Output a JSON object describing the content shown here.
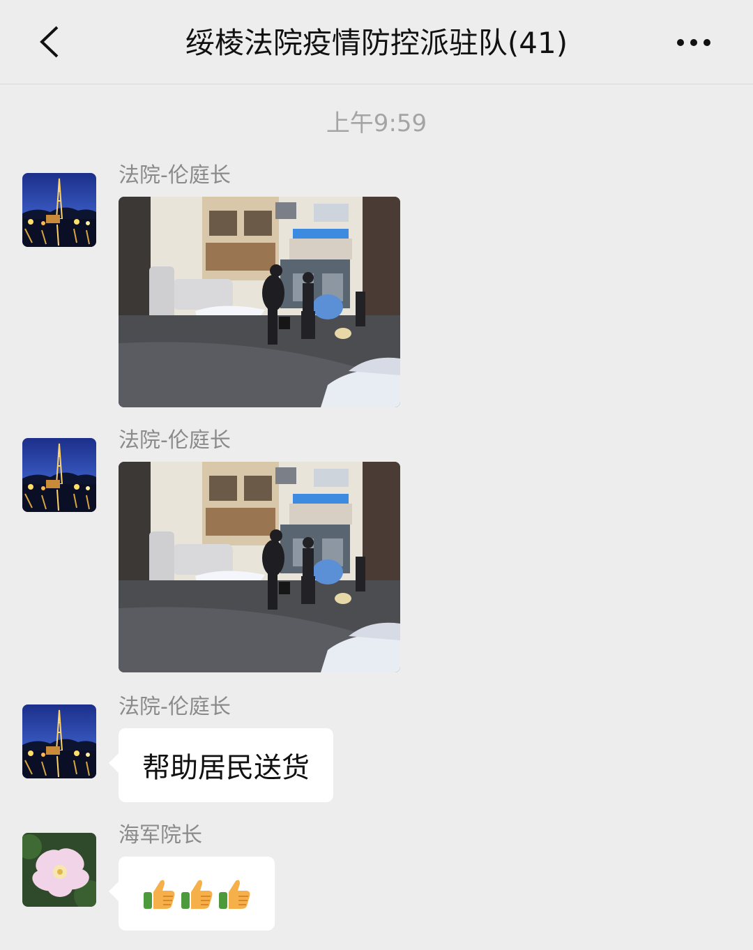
{
  "nav": {
    "back_icon": "chevron-left-icon",
    "title": "绥棱法院疫情防控派驻队(41)",
    "more_icon": "more-dots-icon"
  },
  "chat": {
    "timestamp": "上午9:59",
    "messages": [
      {
        "sender": "法院-伦庭长",
        "type": "image",
        "avatar": "night-tower-avatar",
        "image": "street-scene-photo"
      },
      {
        "sender": "法院-伦庭长",
        "type": "image",
        "avatar": "night-tower-avatar",
        "image": "street-scene-photo"
      },
      {
        "sender": "法院-伦庭长",
        "type": "text",
        "avatar": "night-tower-avatar",
        "text": "帮助居民送货"
      },
      {
        "sender": "海军院长",
        "type": "emoji",
        "avatar": "flower-avatar",
        "emoji": "thumbs-up-icon ×3"
      }
    ]
  },
  "colors": {
    "background": "#ededed",
    "bubble": "#ffffff",
    "meta_text": "#8a8a8a"
  }
}
